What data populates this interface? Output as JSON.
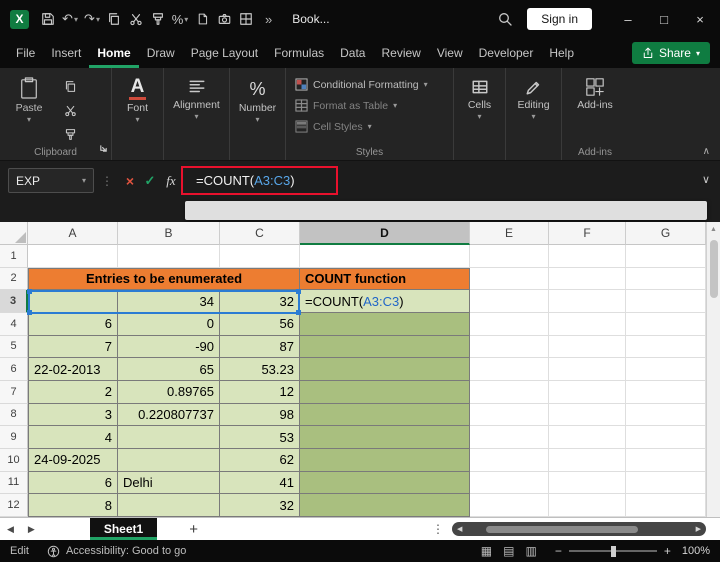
{
  "icons": {
    "chevron_down": "▾",
    "chevron_up": "∧",
    "expand_down": "∨",
    "dots_vertical": "⋮",
    "overflow": "»",
    "undo": "↶",
    "redo": "↷",
    "percent": "%",
    "font_a": "A",
    "logo_x": "X",
    "minimize": "–",
    "maximize": "□",
    "close": "×",
    "cancel": "×",
    "check": "✓",
    "fx": "fx",
    "tri_left": "◀",
    "tri_right": "▶",
    "tri_up": "▲",
    "view_normal": "▦",
    "view_layout": "▤",
    "view_break": "▥",
    "minus": "−",
    "plus": "+"
  },
  "titlebar": {
    "title": "Book...",
    "sign_in": "Sign in"
  },
  "menubar": {
    "items": [
      "File",
      "Insert",
      "Home",
      "Draw",
      "Page Layout",
      "Formulas",
      "Data",
      "Review",
      "View",
      "Developer",
      "Help"
    ],
    "active": "Home",
    "share": "Share"
  },
  "ribbon": {
    "paste": "Paste",
    "font": "Font",
    "alignment": "Alignment",
    "number": "Number",
    "cells": "Cells",
    "editing": "Editing",
    "addins": "Add-ins",
    "cond_format": "Conditional Formatting",
    "format_table": "Format as Table",
    "cell_styles": "Cell Styles",
    "grp_clipboard": "Clipboard",
    "grp_styles": "Styles",
    "grp_addins": "Add-ins"
  },
  "formula": {
    "name_box": "EXP",
    "pre": "=COUNT(",
    "ref": "A3:C3",
    "post": ")"
  },
  "grid": {
    "cols": [
      "A",
      "B",
      "C",
      "D",
      "E",
      "F",
      "G"
    ],
    "rows": [
      "1",
      "2",
      "3",
      "4",
      "5",
      "6",
      "7",
      "8",
      "9",
      "10",
      "11",
      "12"
    ],
    "title_left": "Entries to be enumerated",
    "title_right": "COUNT function",
    "r3": {
      "a": "",
      "b": "34",
      "c": "32"
    },
    "r4": {
      "a": "6",
      "b": "0",
      "c": "56"
    },
    "r5": {
      "a": "7",
      "b": "-90",
      "c": "87"
    },
    "r6": {
      "a": "22-02-2013",
      "b": "65",
      "c": "53.23"
    },
    "r7": {
      "a": "2",
      "b": "0.89765",
      "c": "12"
    },
    "r8": {
      "a": "3",
      "b": "0.220807737",
      "c": "98"
    },
    "r9": {
      "a": "4",
      "b": "",
      "c": "53"
    },
    "r10": {
      "a": "24-09-2025",
      "b": "",
      "c": "62"
    },
    "r11": {
      "a": "6",
      "b": "Delhi",
      "c": "41"
    },
    "r12": {
      "a": "8",
      "b": "",
      "c": "32"
    }
  },
  "sheetbar": {
    "tab": "Sheet1",
    "add": "+"
  },
  "statusbar": {
    "mode": "Edit",
    "accessibility": "Accessibility: Good to go",
    "zoom": "100%"
  },
  "colors": {
    "accent_green": "#107C41",
    "tab_underline_green": "#21A366",
    "orange_fill": "#ED7D31",
    "light_green_fill": "#D8E4BC",
    "dark_green_fill": "#A9BF7F",
    "reference_blue": "#2B7CD3",
    "annotation_red": "#E8112D"
  }
}
